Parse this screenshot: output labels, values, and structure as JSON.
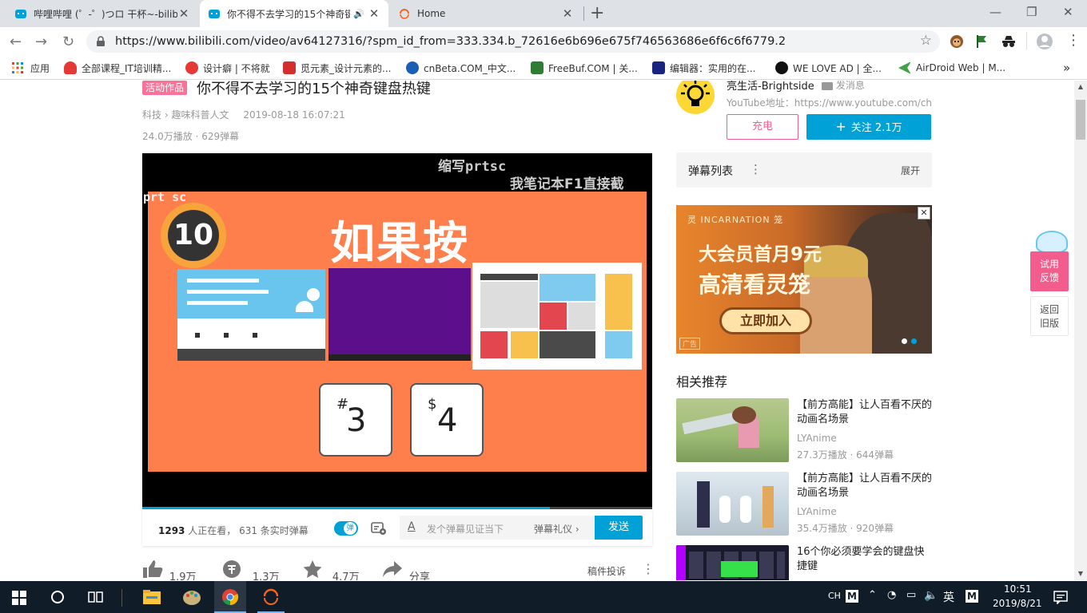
{
  "browser": {
    "tabs": [
      {
        "title": "哔哩哔哩 (゜-゜)つロ 干杯~-bilibili",
        "active": false
      },
      {
        "title": "你不得不去学习的15个神奇键盘热键",
        "active": true,
        "audio": "🔊"
      },
      {
        "title": "Home",
        "active": false
      }
    ],
    "new_tab": "+",
    "url": "https://www.bilibili.com/video/av64127316/?spm_id_from=333.334.b_72616e6b696e675f746563686e6f6c6f6779.2",
    "bookmarks": [
      {
        "label": "应用",
        "color": "#4285f4"
      },
      {
        "label": "全部课程_IT培训精...",
        "color": "#e53935"
      },
      {
        "label": "设计癖 | 不将就",
        "color": "#e53935"
      },
      {
        "label": "觅元素_设计元素的...",
        "color": "#d32f2f"
      },
      {
        "label": "cnBeta.COM_中文...",
        "color": "#1a5fb4"
      },
      {
        "label": "FreeBuf.COM | 关...",
        "color": "#2e7d32"
      },
      {
        "label": "编辑器：实用的在...",
        "color": "#1a237e"
      },
      {
        "label": "WE LOVE AD | 全...",
        "color": "#111111"
      },
      {
        "label": "AirDroid Web | M...",
        "color": "#43a047"
      }
    ],
    "bookmarks_more": "»"
  },
  "video": {
    "badge": "活动作品",
    "title": "你不得不去学习的15个神奇键盘热键",
    "category": "科技",
    "subcategory": "趣味科普人文",
    "date": "2019-08-18 16:07:21",
    "plays": "24.0万播放",
    "danmaku_count": "629弹幕",
    "overlay_line1": "缩写prtsc",
    "overlay_line2": "我笔记本F1直接截",
    "overlay_corner": "prt sc",
    "rank_number": "10",
    "slide_heading": "如果按",
    "key1_symbol": "#",
    "key1_digit": "3",
    "key2_symbol": "$",
    "key2_digit": "4",
    "progress": 0.8
  },
  "danmaku_bar": {
    "viewers": "1293",
    "viewers_suffix": "人正在看，",
    "realtime": "631 条实时弹幕",
    "toggle_label": "弹",
    "input_placeholder": "发个弹幕见证当下",
    "etiquette": "弹幕礼仪",
    "send": "发送"
  },
  "actions": {
    "like": "1.9万",
    "coin": "1.3万",
    "fav": "4.7万",
    "share": "分享",
    "report": "稿件投诉"
  },
  "uploader": {
    "name": "亮生活-Brightside",
    "message": "发消息",
    "desc": "YouTube地址：https://www.youtube.com/cha...",
    "charge": "充电",
    "follow": "关注 2.1万"
  },
  "danmaku_list": {
    "title": "弹幕列表",
    "expand": "展开"
  },
  "ad": {
    "brand": "灵 INCARNATION 笼",
    "line1": "大会员首月9元",
    "line2": "高清看灵笼",
    "cta": "立即加入",
    "tag": "广告"
  },
  "related": {
    "heading": "相关推荐",
    "items": [
      {
        "title": "【前方高能】让人百看不厌的动画名场景",
        "up": "LYAnime",
        "stats": "27.3万播放 · 644弹幕"
      },
      {
        "title": "【前方高能】让人百看不厌的动画名场景",
        "up": "LYAnime",
        "stats": "35.4万播放 · 920弹幕"
      },
      {
        "title": "16个你必须要学会的键盘快捷键",
        "up": "",
        "stats": ""
      }
    ]
  },
  "float": {
    "feedback": "试用反馈",
    "back_old": "返回旧版"
  },
  "taskbar": {
    "ime1": "CH",
    "ime2": "英",
    "time": "10:51",
    "date": "2019/8/21"
  }
}
